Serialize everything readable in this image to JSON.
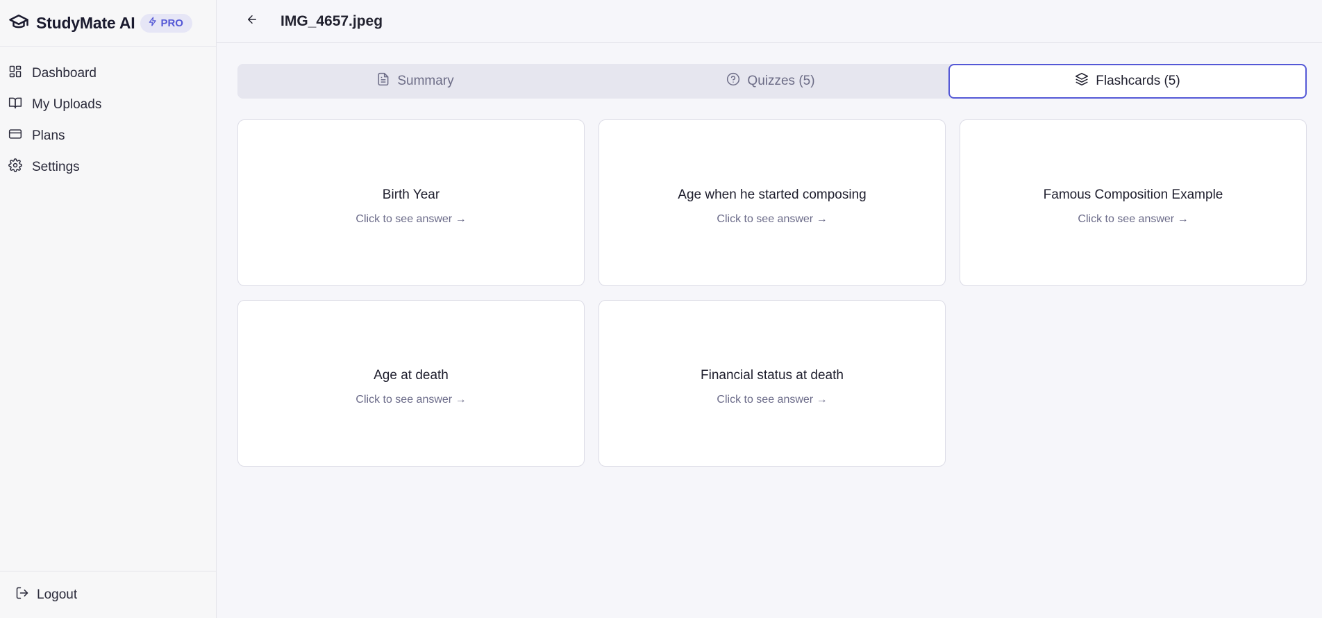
{
  "brand": {
    "name": "StudyMate AI",
    "badge": "PRO"
  },
  "nav": [
    {
      "label": "Dashboard",
      "icon": "dashboard-icon"
    },
    {
      "label": "My Uploads",
      "icon": "book-icon"
    },
    {
      "label": "Plans",
      "icon": "credit-card-icon"
    },
    {
      "label": "Settings",
      "icon": "gear-icon"
    }
  ],
  "logout": {
    "label": "Logout",
    "icon": "logout-icon"
  },
  "header": {
    "title": "IMG_4657.jpeg",
    "back_icon": "arrow-left-icon"
  },
  "tabs": [
    {
      "label": "Summary",
      "icon": "document-icon",
      "active": false
    },
    {
      "label": "Quizzes (5)",
      "icon": "help-circle-icon",
      "active": false
    },
    {
      "label": "Flashcards (5)",
      "icon": "layers-icon",
      "active": true
    }
  ],
  "flashcards": [
    {
      "title": "Birth Year",
      "hint": "Click to see answer →"
    },
    {
      "title": "Age when he started composing",
      "hint": "Click to see answer →"
    },
    {
      "title": "Famous Composition Example",
      "hint": "Click to see answer →"
    },
    {
      "title": "Age at death",
      "hint": "Click to see answer →"
    },
    {
      "title": "Financial status at death",
      "hint": "Click to see answer →"
    }
  ],
  "colors": {
    "accent": "#5458d6",
    "background": "#f6f6fa",
    "badge_bg": "#e6e6f6"
  }
}
